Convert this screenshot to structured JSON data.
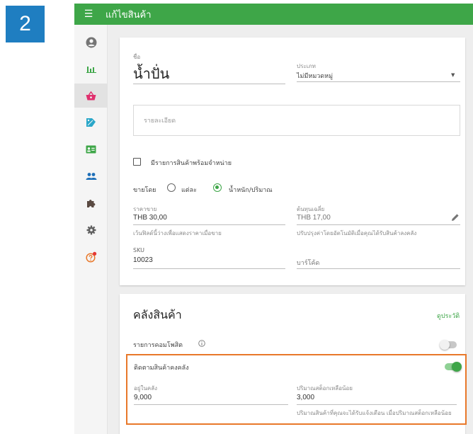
{
  "step_number": "2",
  "topbar": {
    "title": "แก้ไขสินค้า",
    "menu_icon": "hamburger-menu-icon"
  },
  "colors": {
    "primary": "#3ea648",
    "badge": "#1f7ec1",
    "highlight": "#e8782a"
  },
  "sidebar": {
    "items": [
      {
        "icon": "account-circle-icon"
      },
      {
        "icon": "bar-chart-icon"
      },
      {
        "icon": "shopping-basket-icon",
        "active": true
      },
      {
        "icon": "receipt-discount-icon"
      },
      {
        "icon": "contact-card-icon"
      },
      {
        "icon": "people-icon"
      },
      {
        "icon": "puzzle-icon"
      },
      {
        "icon": "settings-gear-icon"
      },
      {
        "icon": "help-notification-icon"
      }
    ]
  },
  "product": {
    "name_label": "ชื่อ",
    "name_value": "น้ำปั่น",
    "category_label": "ประเภท",
    "category_value": "ไม่มีหมวดหมู่",
    "description_placeholder": "รายละเอียด",
    "variants_label": "มีรายการสินค้าพร้อมจำหน่าย",
    "sell_by_label": "ขายโดย",
    "sell_by_options": [
      {
        "label": "แต่ละ",
        "selected": false
      },
      {
        "label": "น้ำหนัก/ปริมาณ",
        "selected": true
      }
    ],
    "price_label": "ราคาขาย",
    "price_value": "THB 30,00",
    "price_hint": "เว้นฟิลด์นี้ว่างเพื่อแสดงราคาเมื่อขาย",
    "cost_label": "ต้นทุนเฉลี่ย",
    "cost_value": "THB 17,00",
    "cost_hint": "ปรับปรุงค่าโดยอัตโนมัติเมื่อคุณได้รับสินค้าลงคลัง",
    "sku_label": "SKU",
    "sku_value": "10023",
    "barcode_placeholder": "บาร์โค้ด"
  },
  "inventory": {
    "title": "คลังสินค้า",
    "view_history_link": "ดูประวัติ",
    "composite_label": "รายการคอมโพสิต",
    "composite_enabled": false,
    "track_stock_label": "ติดตามสินค้าคงคลัง",
    "track_stock_enabled": true,
    "in_stock_label": "อยู่ในคลัง",
    "in_stock_value": "9,000",
    "low_stock_label": "ปริมาณสต็อกเหลือน้อย",
    "low_stock_value": "3,000",
    "low_stock_hint": "ปริมาณสินค้าที่คุณจะได้รับแจ้งเตือน เมื่อปริมาณสต็อกเหลือน้อย"
  }
}
